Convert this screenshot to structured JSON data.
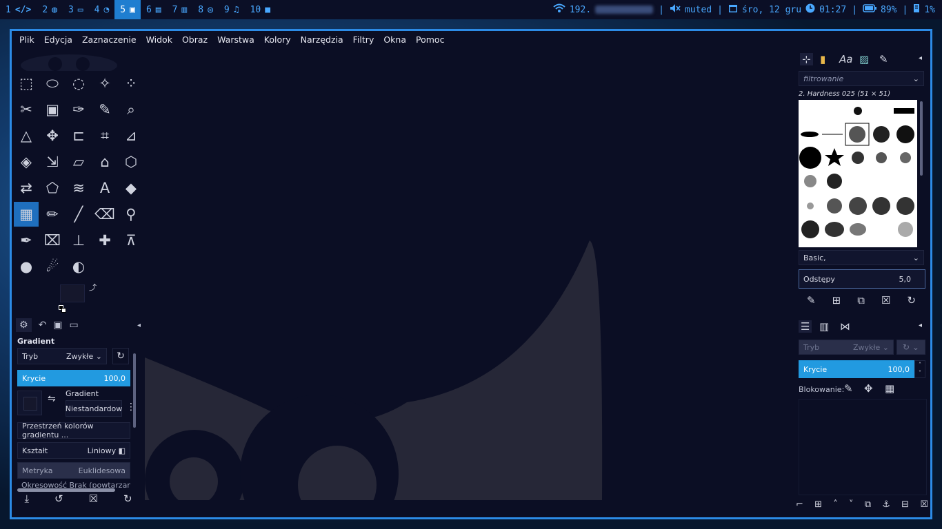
{
  "topbar": {
    "workspaces": [
      {
        "num": "1",
        "icon": "code-icon"
      },
      {
        "num": "2",
        "icon": "globe-icon"
      },
      {
        "num": "3",
        "icon": "folder-icon"
      },
      {
        "num": "4",
        "icon": "chat-icon"
      },
      {
        "num": "5",
        "icon": "image-icon",
        "active": true
      },
      {
        "num": "6",
        "icon": "document-icon"
      },
      {
        "num": "7",
        "icon": "book-icon"
      },
      {
        "num": "8",
        "icon": "gamepad-icon"
      },
      {
        "num": "9",
        "icon": "music-icon"
      },
      {
        "num": "10",
        "icon": "video-icon"
      }
    ],
    "network": "192.",
    "volume": "muted",
    "date": "śro, 12 gru",
    "time": "01:27",
    "battery": "89%",
    "disk": "1%"
  },
  "menubar": [
    "Plik",
    "Edycja",
    "Zaznaczenie",
    "Widok",
    "Obraz",
    "Warstwa",
    "Kolory",
    "Narzędzia",
    "Filtry",
    "Okna",
    "Pomoc"
  ],
  "tool_options": {
    "title": "Gradient",
    "mode_label": "Tryb",
    "mode_value": "Zwykłe",
    "opacity_label": "Krycie",
    "opacity_value": "100,0",
    "gradient_label": "Gradient",
    "gradient_value": "Niestandardow",
    "colorspace": "Przestrzeń kolorów gradientu ...",
    "shape_label": "Kształt",
    "shape_value": "Liniowy",
    "metric_label": "Metryka",
    "metric_value": "Euklidesowa",
    "repeat_partial": "Okresowość   Brak (powtarzanie)"
  },
  "brushes": {
    "filter_placeholder": "filtrowanie",
    "selected": "2. Hardness 025 (51 × 51)",
    "tag": "Basic,",
    "spacing_label": "Odstępy",
    "spacing_value": "5,0"
  },
  "layers": {
    "mode_label": "Tryb",
    "mode_value": "Zwykłe",
    "opacity_label": "Krycie",
    "opacity_value": "100,0",
    "lock_label": "Blokowanie:"
  }
}
